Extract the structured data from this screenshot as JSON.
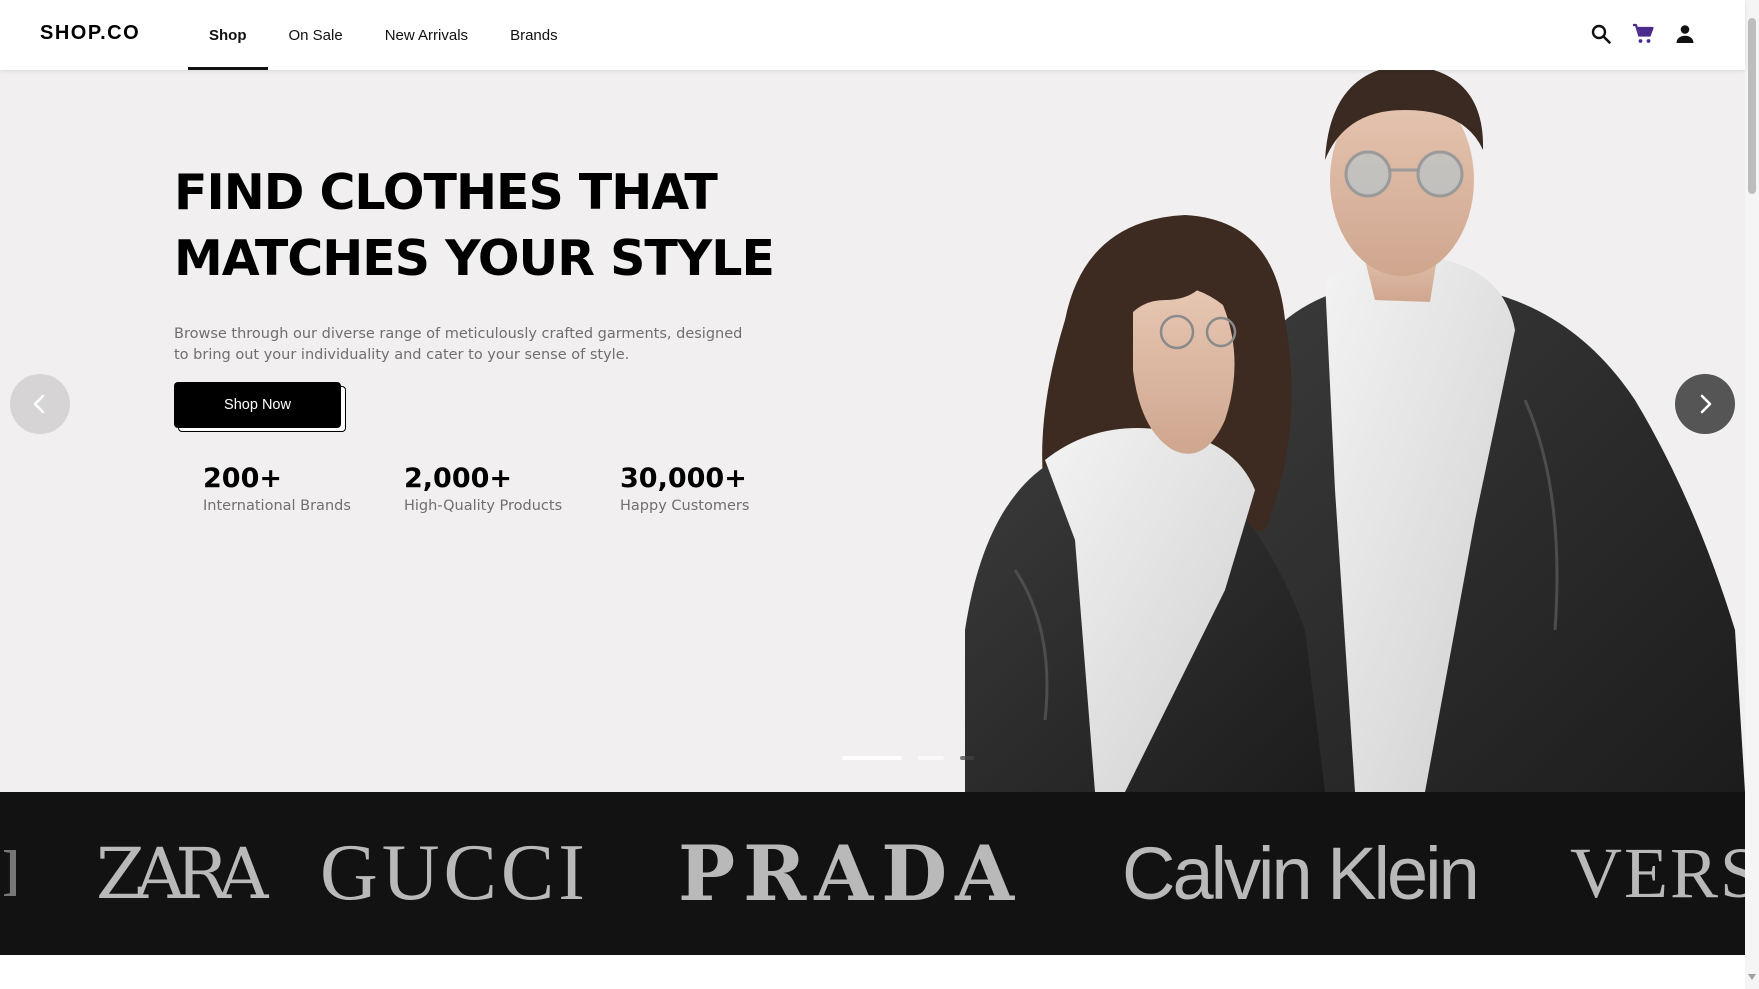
{
  "header": {
    "logo": "SHOP.CO",
    "nav": [
      {
        "label": "Shop",
        "active": true
      },
      {
        "label": "On Sale",
        "active": false
      },
      {
        "label": "New Arrivals",
        "active": false
      },
      {
        "label": "Brands",
        "active": false
      }
    ],
    "icons": [
      "search-icon",
      "cart-icon",
      "account-icon"
    ],
    "cart_icon_color": "#4a2a8c"
  },
  "hero": {
    "title_line1": "FIND CLOTHES THAT",
    "title_line2": "MATCHES YOUR STYLE",
    "description": "Browse through our diverse range of meticulously crafted garments, designed to bring out your individuality and cater to your sense of style.",
    "cta_label": "Shop Now",
    "stats": [
      {
        "value": "200+",
        "label": "International Brands"
      },
      {
        "value": "2,000+",
        "label": "High-Quality Products"
      },
      {
        "value": "30,000+",
        "label": "Happy Customers"
      }
    ],
    "carousel": {
      "slides": 3,
      "active_slide": 1
    },
    "background": "#f1eff0"
  },
  "brands": {
    "logos": [
      "ZARA",
      "GUCCI",
      "PRADA",
      "Calvin Klein",
      "VERS"
    ],
    "background": "#121212"
  }
}
